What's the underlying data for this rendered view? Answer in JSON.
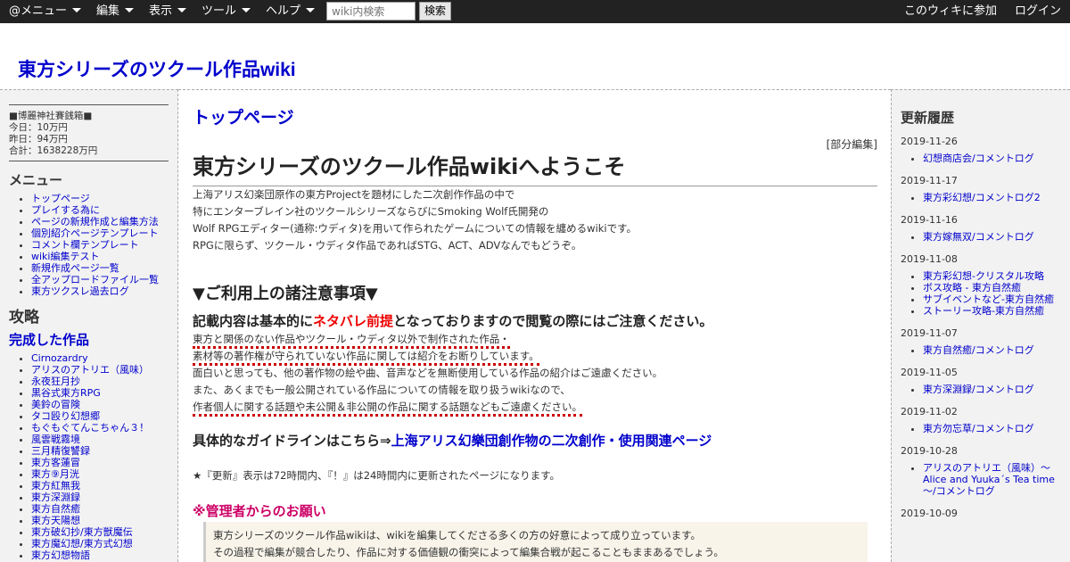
{
  "topbar": {
    "menus": [
      "@メニュー",
      "編集",
      "表示",
      "ツール",
      "ヘルプ"
    ],
    "search_placeholder": "wiki内検索",
    "search_button": "検索",
    "join": "このウィキに参加",
    "login": "ログイン"
  },
  "site_title": "東方シリーズのツクール作品wiki",
  "left": {
    "saisen": {
      "title": "■博麗神社賽銭箱■",
      "today": "今日：10万円",
      "yesterday": "昨日：94万円",
      "total": "合計：1638228万円"
    },
    "menu_title": "メニュー",
    "menu_items": [
      "トップページ",
      "プレイする為に",
      "ページの新規作成と編集方法",
      "個別紹介ページテンプレート",
      "コメント欄テンプレート",
      "wiki編集テスト",
      "新規作成ページ一覧",
      "全アップロードファイル一覧",
      "東方ツクスレ過去ログ"
    ],
    "attack_title": "攻略",
    "completed_title": "完成した作品",
    "games": [
      "Cirnozardry",
      "アリスのアトリエ（風味）",
      "永夜狂月抄",
      "黒谷式東方RPG",
      "美鈴の冒険",
      "タコ殴り幻想郷",
      "もぐもぐてんこちゃん３！",
      "風雲戦霧境",
      "三月精復讐録",
      "東方客蓮冒",
      "東方⑨月洸",
      "東方紅無我",
      "東方深淵録",
      "東方自然癒",
      "東方天陽想",
      "東方破幻抄/東方獣魔伝",
      "東方魔幻想/東方式幻想",
      "東方幻想物語"
    ]
  },
  "main": {
    "page_title": "トップページ",
    "edit_link": "[部分編集]",
    "welcome": "東方シリーズのツクール作品wikiへようこそ",
    "intro_lines": [
      "上海アリス幻楽団原作の東方Projectを題材にした二次創作作品の中で",
      "特にエンターブレイン社のツクールシリーズならびにSmoking Wolf氏開発の",
      "Wolf RPGエディター(通称:ウディタ)を用いて作られたゲームについての情報を纏めるwikiです。",
      "RPGに限らず、ツクール・ウディタ作品であればSTG、ACT、ADVなんでもどうぞ。"
    ],
    "notice_heading": "▼ご利用上の諸注意事項▼",
    "warn_head": {
      "before": "記載内容は基本的に",
      "red": "ネタバレ前提",
      "after": "となっておりますので閲覧の際にはご注意ください。"
    },
    "warn_lines": [
      "東方と関係のない作品やツクール・ウディタ以外で制作された作品・",
      "素材等の著作権が守られていない作品に関しては紹介をお断りしています。",
      "面白いと思っても、他の著作物の絵や曲、音声などを無断使用している作品の紹介はご遠慮ください。",
      "また、あくまでも一般公開されている作品についての情報を取り扱うwikiなので、",
      "作者個人に関する話題や未公開＆非公開の作品に関する話題などもご遠慮ください。"
    ],
    "guideline_text": "具体的なガイドラインはこちら⇒",
    "guideline_link": "上海アリス幻樂団創作物の二次創作・使用関連ページ",
    "update_note": "★『更新』表示は72時間内、『！』は24時間内に更新されたページになります。",
    "admin_head": "※管理者からのお願い",
    "admin_lines": [
      "東方シリーズのツクール作品wikiは、wikiを編集してくださる多くの方の好意によって成り立っています。",
      "その過程で編集が競合したり、作品に対する価値観の衝突によって編集合戦が起こることもままあるでしょう。"
    ]
  },
  "right": {
    "title": "更新履歴",
    "history": [
      {
        "date": "2019-11-26",
        "items": [
          "幻想商店会/コメントログ"
        ]
      },
      {
        "date": "2019-11-17",
        "items": [
          "東方彩幻想/コメントログ2"
        ]
      },
      {
        "date": "2019-11-16",
        "items": [
          "東方嫁無双/コメントログ"
        ]
      },
      {
        "date": "2019-11-08",
        "items": [
          "東方彩幻想-クリスタル攻略",
          "ボス攻略 - 東方自然癒",
          "サブイベントなど-東方自然癒",
          "ストーリー攻略-東方自然癒"
        ]
      },
      {
        "date": "2019-11-07",
        "items": [
          "東方自然癒/コメントログ"
        ]
      },
      {
        "date": "2019-11-05",
        "items": [
          "東方深淵録/コメントログ"
        ]
      },
      {
        "date": "2019-11-02",
        "items": [
          "東方勿忘草/コメントログ"
        ]
      },
      {
        "date": "2019-10-28",
        "items": [
          "アリスのアトリエ（風味）～Alice and Yuuka´s Tea time～/コメントログ"
        ]
      },
      {
        "date": "2019-10-09",
        "items": []
      }
    ]
  }
}
